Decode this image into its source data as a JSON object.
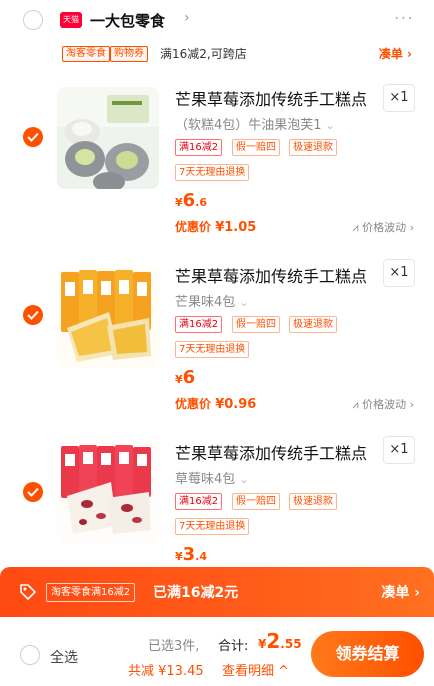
{
  "store": {
    "badge": "天猫",
    "name": "一大包零食",
    "arrow": "›",
    "more": "···"
  },
  "promo": {
    "tag1": "淘客零食",
    "tag2": "购物券",
    "text": "满16减2,可跨店",
    "link": "凑单 ›"
  },
  "items": [
    {
      "title": "芒果草莓添加传统手工糕点",
      "qty": "×1",
      "sku": "（软糕4包）牛油果泡芙1",
      "tags": [
        "满16减2",
        "假一赔四",
        "极速退款",
        "7天无理由退换"
      ],
      "price_yen": "¥",
      "price_int": "6",
      "price_dec": ".6",
      "discount_label": "优惠价",
      "discount_value": "¥1.05",
      "fluct": "价格波动 ›"
    },
    {
      "title": "芒果草莓添加传统手工糕点",
      "qty": "×1",
      "sku": "芒果味4包",
      "tags": [
        "满16减2",
        "假一赔四",
        "极速退款",
        "7天无理由退换"
      ],
      "price_yen": "¥",
      "price_int": "6",
      "price_dec": "",
      "discount_label": "优惠价",
      "discount_value": "¥0.96",
      "fluct": "价格波动 ›"
    },
    {
      "title": "芒果草莓添加传统手工糕点",
      "qty": "×1",
      "sku": "草莓味4包",
      "tags": [
        "满16减2",
        "假一赔四",
        "极速退款",
        "7天无理由退换"
      ],
      "price_yen": "¥",
      "price_int": "3",
      "price_dec": ".4",
      "discount_label": "",
      "discount_value": "",
      "fluct": ""
    }
  ],
  "promo_bar": {
    "tag": "淘客零食满16减2",
    "text": "已满16减2元",
    "link": "凑单 ›"
  },
  "footer": {
    "select_all": "全选",
    "selected": "已选3件,",
    "total_label": "合计:",
    "total_yen": "¥",
    "total_int": "2",
    "total_dec": ".55",
    "saved": "共减 ¥13.45",
    "detail": "查看明细 ^",
    "checkout": "领券结算"
  },
  "colors": {
    "accent": "#ff5000",
    "tmall": "#ff0036"
  }
}
